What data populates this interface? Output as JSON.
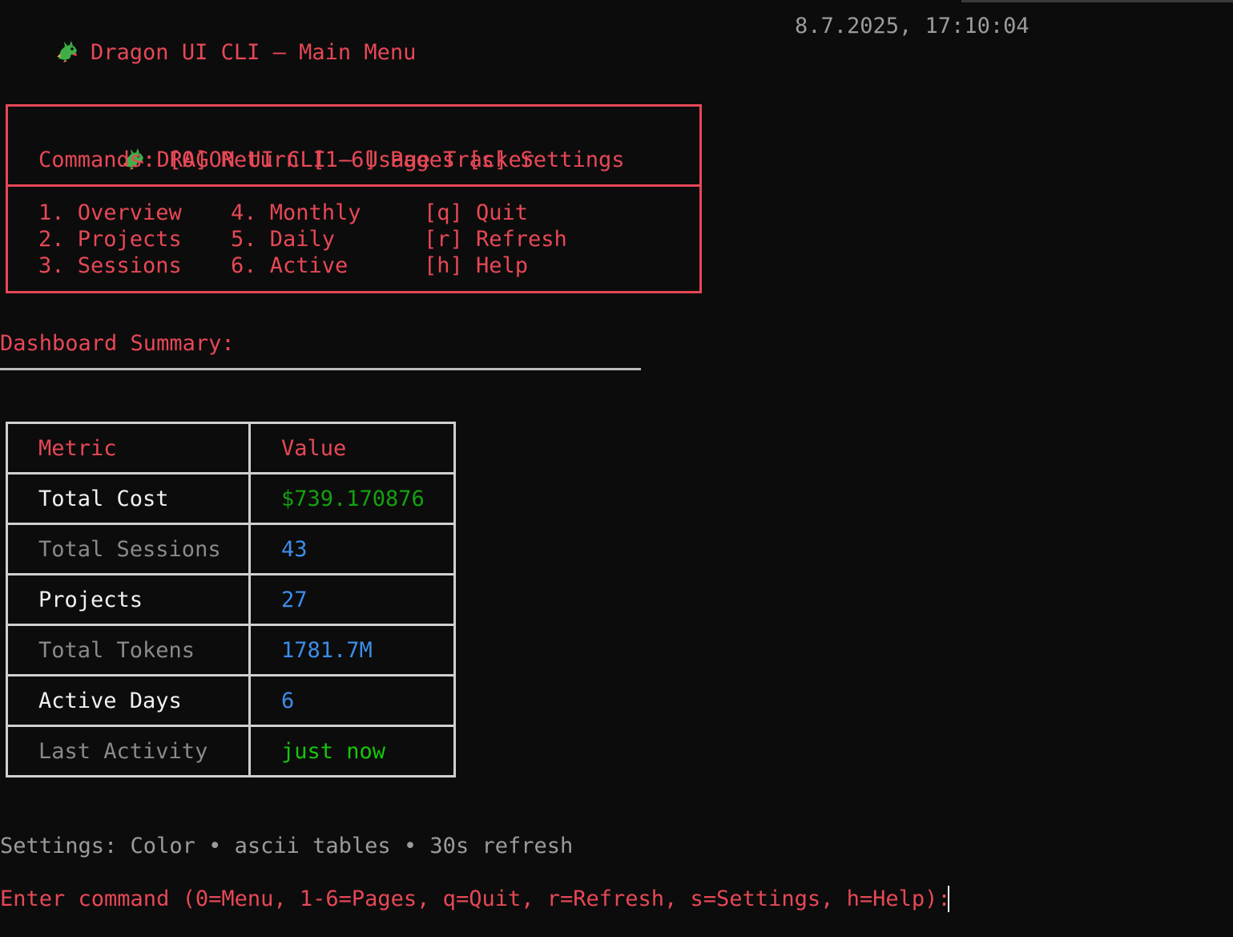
{
  "header": {
    "title": "Dragon UI CLI – Main Menu",
    "datetime": "8.7.2025, 17:10:04"
  },
  "menu_box": {
    "title": "DRAGON UI CLI – Usage Tracker",
    "commands": "Commands: [0] Return [1-6] Pages [s] Settings",
    "pages": [
      {
        "label": "1. Overview"
      },
      {
        "label": "2. Projects"
      },
      {
        "label": "3. Sessions"
      },
      {
        "label": "4. Monthly"
      },
      {
        "label": "5. Daily"
      },
      {
        "label": "6. Active"
      }
    ],
    "actions": [
      {
        "label": "[q] Quit"
      },
      {
        "label": "[r] Refresh"
      },
      {
        "label": "[h] Help"
      }
    ]
  },
  "summary": {
    "title": "Dashboard Summary:",
    "headers": {
      "metric": "Metric",
      "value": "Value"
    },
    "rows": [
      {
        "metric": "Total Cost",
        "value": "$739.170876"
      },
      {
        "metric": "Total Sessions",
        "value": "43"
      },
      {
        "metric": "Projects",
        "value": "27"
      },
      {
        "metric": "Total Tokens",
        "value": "1781.7M"
      },
      {
        "metric": "Active Days",
        "value": "6"
      },
      {
        "metric": "Last Activity",
        "value": "just now"
      }
    ]
  },
  "settings_line": "Settings: Color • ascii tables • 30s refresh",
  "prompt": "Enter command (0=Menu, 1-6=Pages, q=Quit, r=Refresh, s=Settings, h=Help): ",
  "icons": {
    "dragon": "dragon-icon"
  },
  "colors": {
    "accent": "#e74856",
    "cost": "#13a10e",
    "numeric": "#3b8eea",
    "activity": "#16c60c",
    "background": "#0c0c0c"
  }
}
